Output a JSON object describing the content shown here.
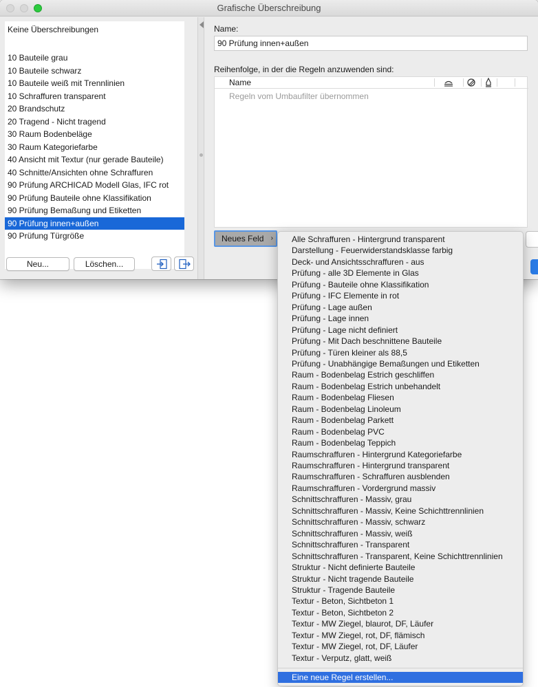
{
  "window": {
    "title": "Grafische Überschreibung"
  },
  "left_panel": {
    "none_item": "Keine Überschreibungen",
    "items": [
      "10 Bauteile grau",
      "10 Bauteile schwarz",
      "10 Bauteile weiß mit Trennlinien",
      "10 Schraffuren transparent",
      "20 Brandschutz",
      "20 Tragend - Nicht tragend",
      "30 Raum Bodenbeläge",
      "30 Raum Kategoriefarbe",
      "40 Ansicht mit Textur (nur gerade Bauteile)",
      "40 Schnitte/Ansichten ohne Schraffuren",
      "90 Prüfung ARCHICAD Modell Glas, IFC rot",
      "90 Prüfung Bauteile ohne Klassifikation",
      "90 Prüfung Bemaßung und Etiketten",
      "90 Prüfung innen+außen",
      "90 Prüfung Türgröße"
    ],
    "selected_index": 13,
    "new_button": "Neu...",
    "delete_button": "Löschen...",
    "icons": [
      "import-icon",
      "export-icon"
    ]
  },
  "details": {
    "name_label": "Name:",
    "name_value": "90 Prüfung innen+außen",
    "order_label": "Reihenfolge, in der die Regeln anzuwenden sind:",
    "column_name": "Name",
    "column_icons": [
      "surface-override-icon",
      "fill-override-icon",
      "pen-override-icon"
    ],
    "empty_text": "Regeln vom Umbaufilter übernommen",
    "add_button": "Neues Feld"
  },
  "menu": {
    "items": [
      "Alle Schraffuren - Hintergrund transparent",
      "Darstellung - Feuerwiderstandsklasse farbig",
      "Deck- und Ansichtsschraffuren - aus",
      "Prüfung - alle 3D Elemente in Glas",
      "Prüfung - Bauteile ohne Klassifikation",
      "Prüfung - IFC Elemente in rot",
      "Prüfung - Lage außen",
      "Prüfung - Lage innen",
      "Prüfung - Lage nicht definiert",
      "Prüfung - Mit Dach beschnittene Bauteile",
      "Prüfung - Türen kleiner als 88,5",
      "Prüfung - Unabhängige Bemaßungen und Etiketten",
      "Raum - Bodenbelag Estrich geschliffen",
      "Raum - Bodenbelag Estrich unbehandelt",
      "Raum - Bodenbelag Fliesen",
      "Raum - Bodenbelag Linoleum",
      "Raum - Bodenbelag Parkett",
      "Raum - Bodenbelag PVC",
      "Raum - Bodenbelag Teppich",
      "Raumschraffuren - Hintergrund Kategoriefarbe",
      "Raumschraffuren - Hintergrund transparent",
      "Raumschraffuren - Schraffuren ausblenden",
      "Raumschraffuren - Vordergrund massiv",
      "Schnittschraffuren - Massiv, grau",
      "Schnittschraffuren - Massiv, Keine Schichttrennlinien",
      "Schnittschraffuren - Massiv, schwarz",
      "Schnittschraffuren - Massiv, weiß",
      "Schnittschraffuren - Transparent",
      "Schnittschraffuren - Transparent, Keine Schichttrennlinien",
      "Struktur - Nicht definierte Bauteile",
      "Struktur - Nicht tragende Bauteile",
      "Struktur - Tragende Bauteile",
      "Textur - Beton, Sichtbeton 1",
      "Textur - Beton, Sichtbeton 2",
      "Textur - MW Ziegel, blaurot, DF, Läufer",
      "Textur - MW Ziegel, rot, DF, flämisch",
      "Textur - MW Ziegel, rot, DF, Läufer",
      "Textur - Verputz, glatt, weiß"
    ],
    "create_new": "Eine neue Regel erstellen..."
  },
  "colors": {
    "selection": "#1968d8",
    "menu_highlight": "#2f6fe0",
    "accent_border": "#5795e4"
  }
}
